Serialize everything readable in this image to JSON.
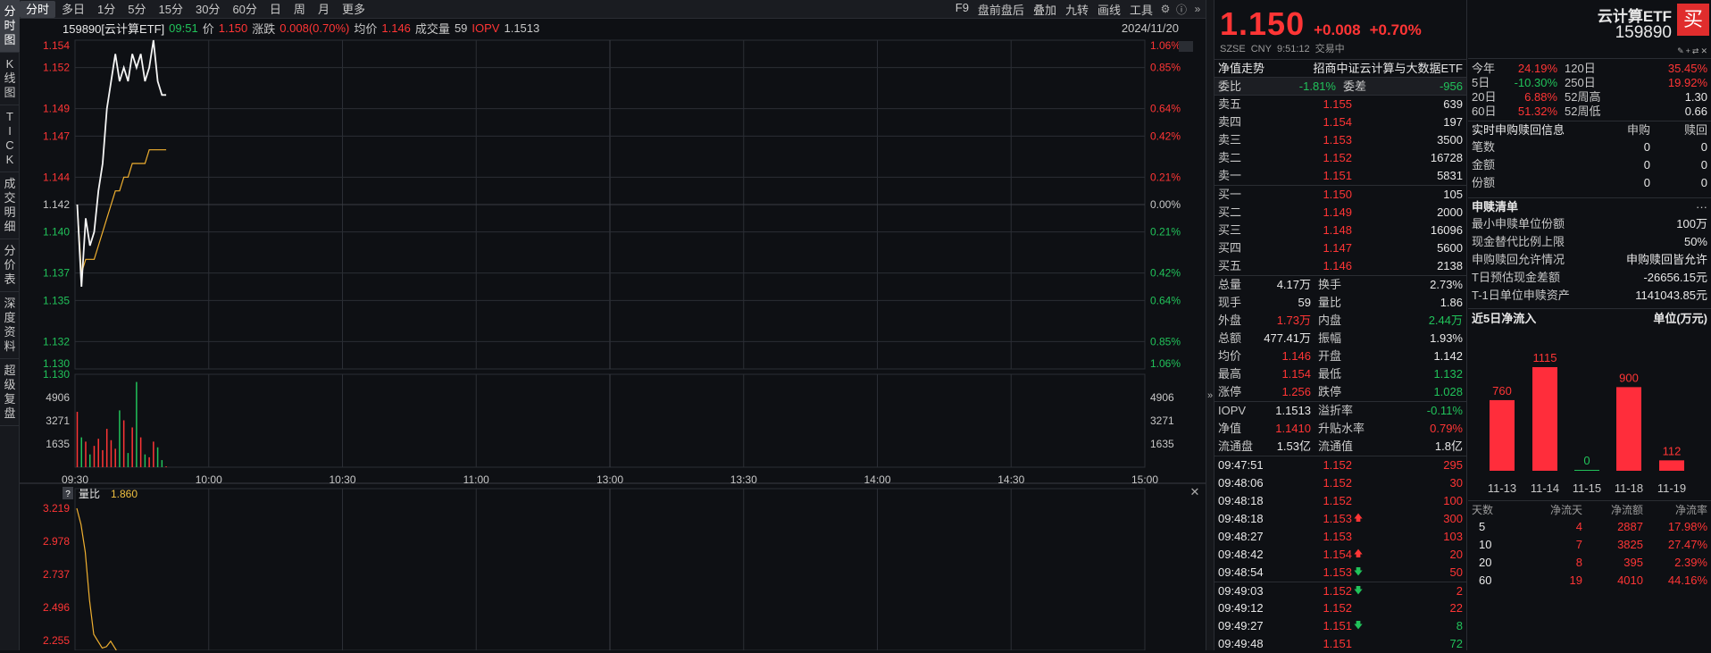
{
  "left_tabs": [
    [
      "分",
      "时",
      "图"
    ],
    [
      "K",
      "线",
      "图"
    ],
    [
      "T",
      "I",
      "C",
      "K"
    ],
    [
      "成",
      "交",
      "明",
      "细"
    ],
    [
      "分",
      "价",
      "表"
    ],
    [
      "深",
      "度",
      "资",
      "料"
    ],
    [
      "超",
      "级",
      "复",
      "盘"
    ]
  ],
  "period_tabs": [
    "分时",
    "多日",
    "1分",
    "5分",
    "15分",
    "30分",
    "60分",
    "日",
    "周",
    "月",
    "更多"
  ],
  "toolbar": [
    "F9",
    "盘前盘后",
    "叠加",
    "九转",
    "画线",
    "工具"
  ],
  "info": {
    "code_name": "159890[云计算ETF]",
    "time": "09:51",
    "price_label": "价",
    "price": "1.150",
    "chg_label": "涨跌",
    "chg": "0.008(0.70%)",
    "avg_label": "均价",
    "avg": "1.146",
    "vol_label": "成交量",
    "vol": "59",
    "iopv_label": "IOPV",
    "iopv": "1.1513",
    "date": "2024/11/20"
  },
  "price_axis": {
    "left": [
      "1.154",
      "1.152",
      "1.149",
      "1.147",
      "1.144",
      "1.142",
      "1.140",
      "1.137",
      "1.135",
      "1.132",
      "1.130"
    ],
    "right": [
      "1.06%",
      "0.85%",
      "0.64%",
      "0.42%",
      "0.21%",
      "0.00%",
      "0.21%",
      "0.42%",
      "0.64%",
      "0.85%",
      "1.06%"
    ]
  },
  "vol_axis": [
    "4906",
    "3271",
    "1635"
  ],
  "time_axis": [
    "09:30",
    "10:00",
    "10:30",
    "11:00",
    "13:00",
    "13:30",
    "14:00",
    "14:30",
    "15:00"
  ],
  "ratio_panel": {
    "help": "?",
    "label": "量比",
    "value": "1.860",
    "axis": [
      "3.219",
      "2.978",
      "2.737",
      "2.496",
      "2.255"
    ]
  },
  "chart_data": {
    "type": "line",
    "title": "159890[云计算ETF] 分时",
    "x": [
      "09:30",
      "09:31",
      "09:32",
      "09:33",
      "09:34",
      "09:35",
      "09:36",
      "09:37",
      "09:38",
      "09:39",
      "09:40",
      "09:41",
      "09:42",
      "09:43",
      "09:44",
      "09:45",
      "09:46",
      "09:47",
      "09:48",
      "09:49",
      "09:50",
      "09:51"
    ],
    "series": [
      {
        "name": "价",
        "values": [
          1.142,
          1.136,
          1.141,
          1.139,
          1.14,
          1.143,
          1.145,
          1.149,
          1.151,
          1.153,
          1.151,
          1.152,
          1.151,
          1.153,
          1.152,
          1.153,
          1.151,
          1.152,
          1.154,
          1.151,
          1.15,
          1.15
        ]
      },
      {
        "name": "均价",
        "values": [
          1.142,
          1.137,
          1.138,
          1.138,
          1.138,
          1.139,
          1.14,
          1.141,
          1.142,
          1.143,
          1.143,
          1.144,
          1.144,
          1.145,
          1.145,
          1.145,
          1.145,
          1.146,
          1.146,
          1.146,
          1.146,
          1.146
        ]
      },
      {
        "name": "成交量",
        "values": [
          3900,
          2100,
          1800,
          900,
          1500,
          2000,
          1200,
          2700,
          1900,
          1300,
          4000,
          3300,
          1000,
          2800,
          6000,
          2100,
          900,
          700,
          1800,
          1400,
          500,
          59
        ]
      },
      {
        "name": "量比",
        "values": [
          3.219,
          3.1,
          2.9,
          2.55,
          2.3,
          2.25,
          2.2,
          2.21,
          2.25,
          2.2,
          2.15
        ]
      }
    ],
    "ylim": [
      1.13,
      1.154
    ],
    "vol_ylim": [
      0,
      6540
    ],
    "ratio_ylim": [
      2.1,
      3.3
    ],
    "base": 1.142,
    "total_minutes": 240
  },
  "quote": {
    "price": "1.150",
    "change": "+0.008",
    "pct": "+0.70%",
    "exchange": "SZSE",
    "currency": "CNY",
    "time": "9:51:12",
    "status": "交易中",
    "nav_label": "净值走势",
    "full_name": "招商中证云计算与大数据ETF",
    "webi_label": "委比",
    "webi": "-1.81%",
    "weicha_label": "委差",
    "weicha": "-956",
    "asks": [
      [
        "卖五",
        "1.155",
        "639"
      ],
      [
        "卖四",
        "1.154",
        "197"
      ],
      [
        "卖三",
        "1.153",
        "3500"
      ],
      [
        "卖二",
        "1.152",
        "16728"
      ],
      [
        "卖一",
        "1.151",
        "5831"
      ]
    ],
    "bids": [
      [
        "买一",
        "1.150",
        "105"
      ],
      [
        "买二",
        "1.149",
        "2000"
      ],
      [
        "买三",
        "1.148",
        "16096"
      ],
      [
        "买四",
        "1.147",
        "5600"
      ],
      [
        "买五",
        "1.146",
        "2138"
      ]
    ],
    "stats": [
      [
        "总量",
        "4.17万",
        "w",
        "换手",
        "2.73%",
        "w"
      ],
      [
        "现手",
        "59",
        "w",
        "量比",
        "1.86",
        "w"
      ],
      [
        "外盘",
        "1.73万",
        "r",
        "内盘",
        "2.44万",
        "g"
      ],
      [
        "总额",
        "477.41万",
        "w",
        "振幅",
        "1.93%",
        "w"
      ],
      [
        "均价",
        "1.146",
        "r",
        "开盘",
        "1.142",
        "w"
      ],
      [
        "最高",
        "1.154",
        "r",
        "最低",
        "1.132",
        "g"
      ],
      [
        "涨停",
        "1.256",
        "r",
        "跌停",
        "1.028",
        "g"
      ]
    ],
    "stats2": [
      [
        "IOPV",
        "1.1513",
        "w",
        "溢折率",
        "-0.11%",
        "g"
      ],
      [
        "净值",
        "1.1410",
        "r",
        "升贴水率",
        "0.79%",
        "r"
      ],
      [
        "流通盘",
        "1.53亿",
        "w",
        "流通值",
        "1.8亿",
        "w"
      ]
    ],
    "ticks": [
      [
        "09:47:51",
        "1.152",
        "",
        "295"
      ],
      [
        "09:48:06",
        "1.152",
        "",
        "30"
      ],
      [
        "09:48:18",
        "1.152",
        "",
        "100"
      ],
      [
        "09:48:18",
        "1.153",
        "up",
        "300"
      ],
      [
        "09:48:27",
        "1.153",
        "",
        "103"
      ],
      [
        "09:48:42",
        "1.154",
        "up",
        "20"
      ],
      [
        "09:48:54",
        "1.153",
        "down",
        "50"
      ],
      [
        "09:49:03",
        "1.152",
        "down",
        "2"
      ],
      [
        "09:49:12",
        "1.152",
        "",
        "22"
      ],
      [
        "09:49:27",
        "1.151",
        "down",
        "8"
      ],
      [
        "09:49:48",
        "1.151",
        "",
        "72"
      ]
    ]
  },
  "rightp": {
    "name": "云计算ETF",
    "code": "159890",
    "buy": "买",
    "perf": [
      [
        "今年",
        "24.19%",
        "120日",
        "35.45%"
      ],
      [
        "5日",
        "-10.30%",
        "250日",
        "19.92%"
      ],
      [
        "20日",
        "6.88%",
        "52周高",
        "1.30"
      ],
      [
        "60日",
        "51.32%",
        "52周低",
        "0.66"
      ]
    ],
    "sg_title": "实时申购赎回信息",
    "sg_h1": "申购",
    "sg_h2": "赎回",
    "sg_rows": [
      [
        "笔数",
        "0",
        "0"
      ],
      [
        "金额",
        "0",
        "0"
      ],
      [
        "份额",
        "0",
        "0"
      ]
    ],
    "list_title": "申赎清单",
    "more": "···",
    "list_rows": [
      [
        "最小申赎单位份额",
        "100万"
      ],
      [
        "现金替代比例上限",
        "50%"
      ],
      [
        "申购赎回允许情况",
        "申购赎回皆允许"
      ],
      [
        "T日预估现金差额",
        "-26656.15元"
      ],
      [
        "T-1日单位申赎资产",
        "1141043.85元"
      ]
    ],
    "flow_title": "近5日净流入",
    "flow_unit": "单位(万元)",
    "flow_bars": [
      [
        "11-13",
        760
      ],
      [
        "11-14",
        1115
      ],
      [
        "11-15",
        0
      ],
      [
        "11-18",
        900
      ],
      [
        "11-19",
        112
      ]
    ],
    "flow_table_header": [
      "天数",
      "净流天",
      "净流额",
      "净流率"
    ],
    "flow_table": [
      [
        "5",
        "4",
        "2887",
        "17.98%"
      ],
      [
        "10",
        "7",
        "3825",
        "27.47%"
      ],
      [
        "20",
        "8",
        "395",
        "2.39%"
      ],
      [
        "60",
        "19",
        "4010",
        "44.16%"
      ]
    ]
  }
}
